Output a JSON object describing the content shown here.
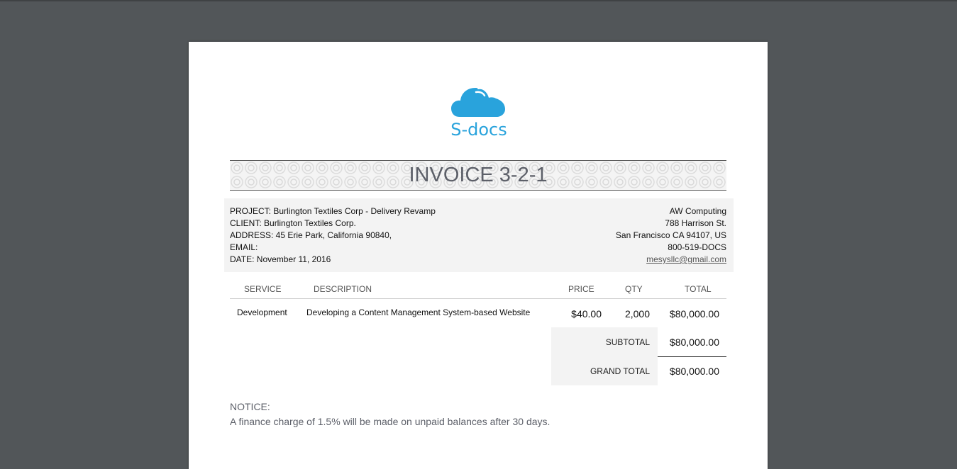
{
  "brand": {
    "logo_text": "S-docs",
    "logo_color": "#29a3dc"
  },
  "invoice": {
    "title": "INVOICE 3-2-1"
  },
  "client_info": {
    "project": "PROJECT: Burlington Textiles Corp - Delivery Revamp",
    "client": "CLIENT: Burlington Textiles Corp.",
    "address": "ADDRESS: 45 Erie Park, California 90840,",
    "email": "EMAIL:",
    "date": "DATE: November 11, 2016"
  },
  "company_info": {
    "name": "AW Computing",
    "street": "788 Harrison St.",
    "city": "San Francisco CA 94107, US",
    "phone": "800-519-DOCS",
    "email": "mesysllc@gmail.com"
  },
  "table": {
    "headers": {
      "service": "SERVICE",
      "description": "DESCRIPTION",
      "price": "PRICE",
      "qty": "QTY",
      "total": "TOTAL"
    },
    "rows": [
      {
        "service": "Development",
        "description": "Developing a Content Management System-based Website",
        "price": "$40.00",
        "qty": "2,000",
        "total": "$80,000.00"
      }
    ]
  },
  "totals": {
    "subtotal_label": "SUBTOTAL",
    "subtotal_value": "$80,000.00",
    "grand_total_label": "GRAND TOTAL",
    "grand_total_value": "$80,000.00"
  },
  "notice": {
    "title": "NOTICE:",
    "text": "A finance charge of 1.5% will be made on unpaid balances after 30 days."
  }
}
